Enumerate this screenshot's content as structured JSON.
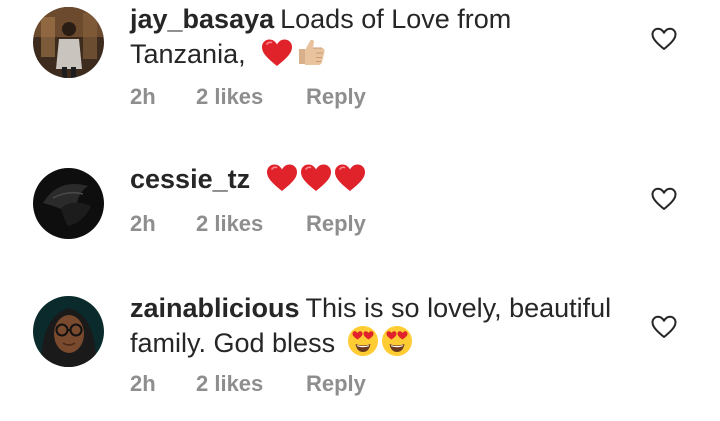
{
  "comments": [
    {
      "username": "jay_basaya",
      "text": "Loads of Love from Tanzania,",
      "emojis": [
        "red-heart",
        "thumbs-up"
      ],
      "time": "2h",
      "likes": "2 likes",
      "reply": "Reply"
    },
    {
      "username": "cessie_tz",
      "text": "",
      "emojis": [
        "red-heart",
        "red-heart",
        "red-heart"
      ],
      "time": "2h",
      "likes": "2 likes",
      "reply": "Reply"
    },
    {
      "username": "zainablicious",
      "text": "This is so lovely, beautiful family. God bless",
      "emojis": [
        "heart-eyes",
        "heart-eyes"
      ],
      "time": "2h",
      "likes": "2 likes",
      "reply": "Reply"
    }
  ],
  "colors": {
    "text": "#262626",
    "meta": "#8e8e8e",
    "heart_emoji": "#e0222b"
  },
  "icons": {
    "like": "heart-outline-icon"
  }
}
